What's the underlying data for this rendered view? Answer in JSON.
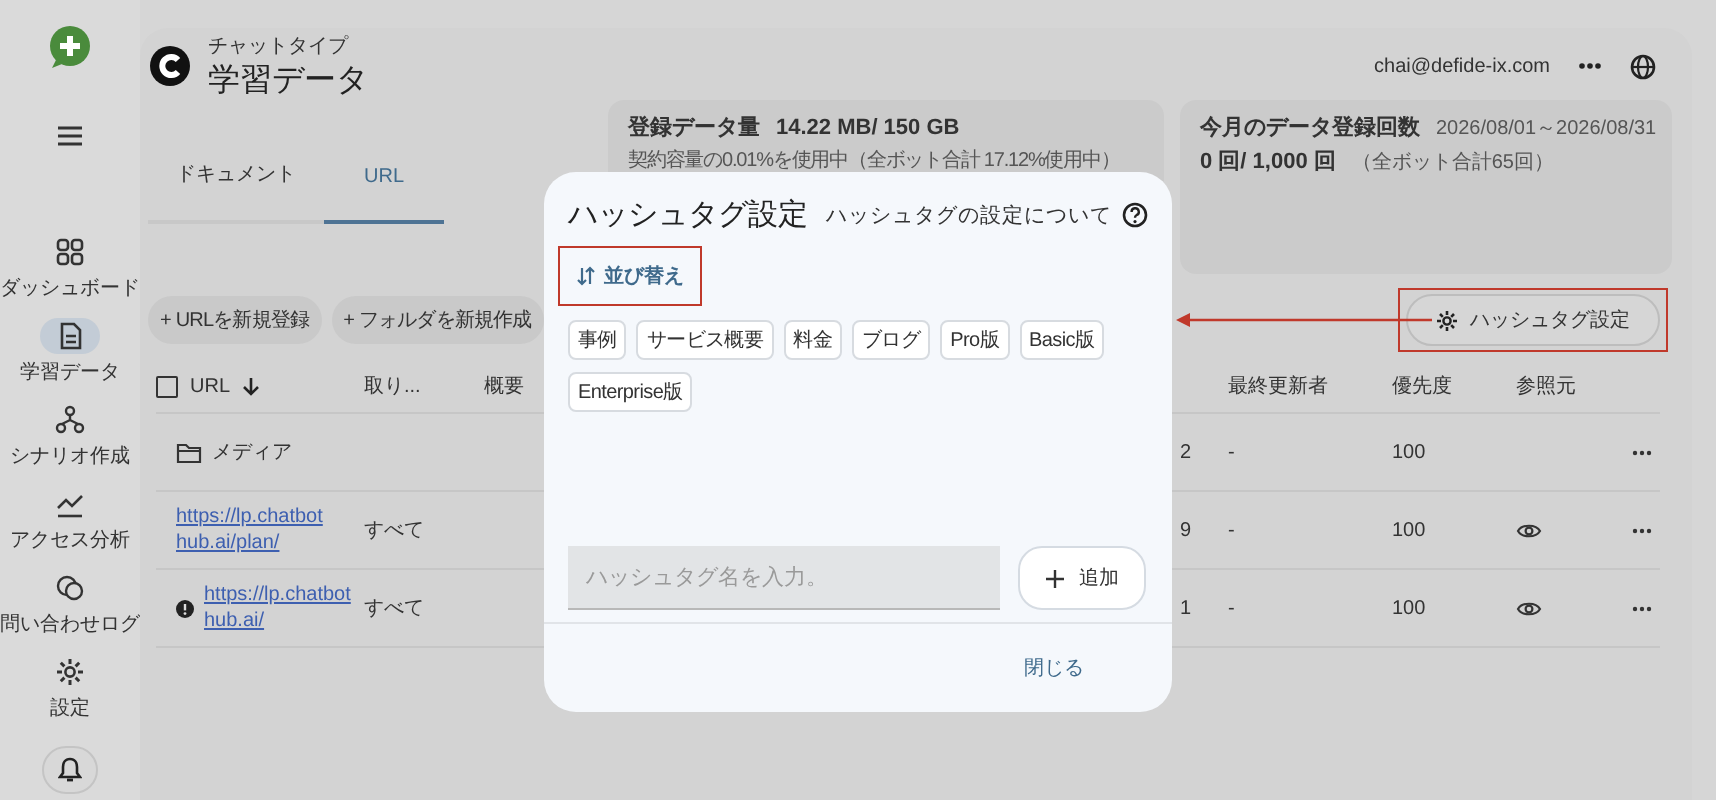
{
  "sidebar": {
    "items": [
      {
        "label": "ダッシュボード",
        "selected": false
      },
      {
        "label": "学習データ",
        "selected": true
      },
      {
        "label": "シナリオ作成",
        "selected": false
      },
      {
        "label": "アクセス分析",
        "selected": false
      },
      {
        "label": "問い合わせログ",
        "selected": false
      },
      {
        "label": "設定",
        "selected": false
      }
    ]
  },
  "header": {
    "subtitle": "チャットタイプ",
    "title": "学習データ",
    "email": "chai@defide-ix.com"
  },
  "tabs": [
    {
      "label": "ドキュメント",
      "selected": false
    },
    {
      "label": "URL",
      "selected": true
    }
  ],
  "storage_card": {
    "title": "登録データ量",
    "value": "14.22 MB/ 150 GB",
    "note": "契約容量の0.01%を使用中（全ボット合計 17.12%使用中）"
  },
  "monthly_card": {
    "title": "今月のデータ登録回数",
    "period": "2026/08/01～2026/08/31",
    "value": "0 回/ 1,000 回",
    "note": "（全ボット合計65回）"
  },
  "actions": [
    "+ URLを新規登録",
    "+ フォルダを新規作成"
  ],
  "hashtag_button": "ハッシュタグ設定",
  "table": {
    "select_all": {
      "checked": false
    },
    "columns": [
      "URL",
      "取り...",
      "概要",
      "最終更新者",
      "優先度",
      "参照元"
    ],
    "rows": [
      {
        "kind": "folder",
        "name": "メディア",
        "column_4": "2",
        "updater": "-",
        "priority": "100",
        "has_reference": false,
        "warning": false
      },
      {
        "kind": "link",
        "name": "https://lp.chatbothub.ai/plan/",
        "scope": "すべて",
        "column_4": "9",
        "updater": "-",
        "priority": "100",
        "has_reference": true,
        "warning": false
      },
      {
        "kind": "link",
        "name": "https://lp.chatbothub.ai/",
        "scope": "すべて",
        "column_4": "1",
        "updater": "-",
        "priority": "100",
        "has_reference": true,
        "warning": true
      }
    ]
  },
  "modal": {
    "title": "ハッシュタグ設定",
    "help_link": "ハッシュタグの設定について",
    "sort_button": "並び替え",
    "tags": [
      "事例",
      "サービス概要",
      "料金",
      "ブログ",
      "Pro版",
      "Basic版",
      "Enterprise版"
    ],
    "input": {
      "placeholder": "ハッシュタグ名を入力。"
    },
    "add_button": "追加",
    "close_button": "閉じる"
  }
}
